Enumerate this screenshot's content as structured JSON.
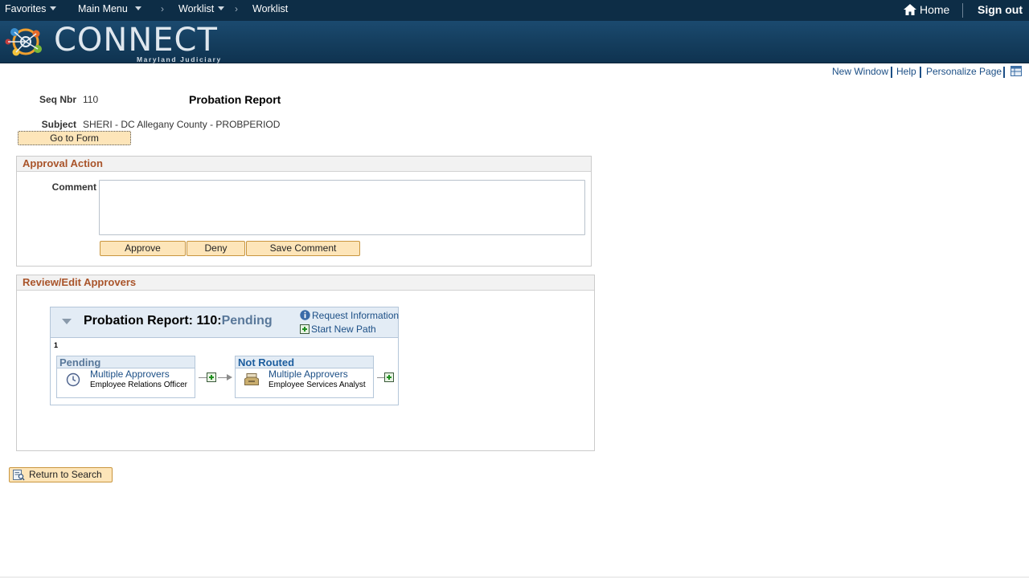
{
  "nav": {
    "favorites": "Favorites",
    "main_menu": "Main Menu",
    "breadcrumb_1": "Worklist",
    "breadcrumb_2": "Worklist",
    "home": "Home",
    "sign_out": "Sign out"
  },
  "banner": {
    "logo_text": "CONNECT",
    "logo_subtitle": "Maryland Judiciary"
  },
  "page_links": {
    "new_window": "New Window",
    "help": "Help",
    "personalize": "Personalize Page"
  },
  "header": {
    "seq_label": "Seq Nbr",
    "seq_value": "110",
    "title": "Probation Report",
    "subject_label": "Subject",
    "subject_value": "SHERI - DC Allegany County - PROBPERIOD",
    "go_to_form": "Go to Form"
  },
  "approval_action": {
    "title": "Approval Action",
    "comment_label": "Comment",
    "comment_value": "",
    "approve": "Approve",
    "deny": "Deny",
    "save_comment": "Save Comment"
  },
  "approvers": {
    "title": "Review/Edit Approvers",
    "map_title": "Probation Report: 110:",
    "map_status": "Pending",
    "request_information": "Request Information",
    "start_new_path": "Start New Path",
    "path_number": "1",
    "steps": [
      {
        "status": "Pending",
        "name": "Multiple Approvers",
        "role": "Employee Relations Officer",
        "status_color": "#59789a"
      },
      {
        "status": "Not Routed",
        "name": "Multiple Approvers",
        "role": "Employee Services Analyst",
        "status_color": "#1c5d9e"
      }
    ]
  },
  "return_to_search": "Return to Search",
  "colors": {
    "nav_bg": "#0d2d46",
    "section_title": "#a9542a",
    "link": "#1c4f86",
    "button_bg": "#fde5b9"
  }
}
